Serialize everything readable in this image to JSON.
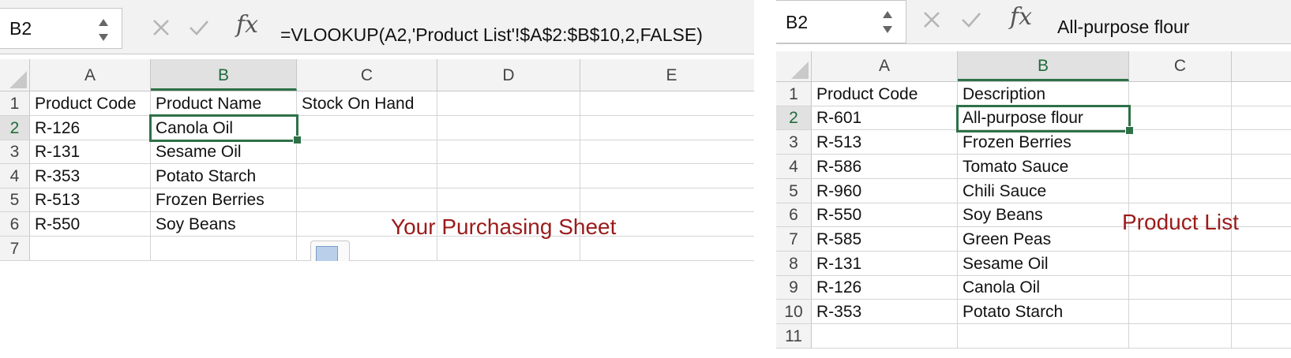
{
  "left": {
    "name_box": "B2",
    "formula": "=VLOOKUP(A2,'Product List'!$A$2:$B$10,2,FALSE)",
    "fx": "fx",
    "columns": [
      "A",
      "B",
      "C",
      "D",
      "E"
    ],
    "rows": [
      {
        "num": "1",
        "a": "Product Code",
        "b": "Product Name",
        "c": "Stock On Hand"
      },
      {
        "num": "2",
        "a": "R-126",
        "b": "Canola Oil",
        "c": ""
      },
      {
        "num": "3",
        "a": "R-131",
        "b": "Sesame Oil",
        "c": ""
      },
      {
        "num": "4",
        "a": "R-353",
        "b": "Potato Starch",
        "c": ""
      },
      {
        "num": "5",
        "a": "R-513",
        "b": "Frozen Berries",
        "c": ""
      },
      {
        "num": "6",
        "a": "R-550",
        "b": "Soy Beans",
        "c": ""
      },
      {
        "num": "7",
        "a": "",
        "b": "",
        "c": ""
      }
    ],
    "annotation": "Your Purchasing Sheet"
  },
  "right": {
    "name_box": "B2",
    "formula": "All-purpose flour",
    "fx": "fx",
    "columns": [
      "A",
      "B",
      "C"
    ],
    "rows": [
      {
        "num": "1",
        "a": "Product Code",
        "b": "Description"
      },
      {
        "num": "2",
        "a": "R-601",
        "b": "All-purpose flour"
      },
      {
        "num": "3",
        "a": "R-513",
        "b": "Frozen Berries"
      },
      {
        "num": "4",
        "a": "R-586",
        "b": "Tomato Sauce"
      },
      {
        "num": "5",
        "a": "R-960",
        "b": "Chili Sauce"
      },
      {
        "num": "6",
        "a": "R-550",
        "b": "Soy Beans"
      },
      {
        "num": "7",
        "a": "R-585",
        "b": "Green Peas"
      },
      {
        "num": "8",
        "a": "R-131",
        "b": "Sesame Oil"
      },
      {
        "num": "9",
        "a": "R-126",
        "b": "Canola Oil"
      },
      {
        "num": "10",
        "a": "R-353",
        "b": "Potato Starch"
      },
      {
        "num": "11",
        "a": "",
        "b": ""
      }
    ],
    "annotation": "Product List"
  },
  "colors": {
    "selection": "#2e7148",
    "annotation": "#9b1b1b"
  }
}
